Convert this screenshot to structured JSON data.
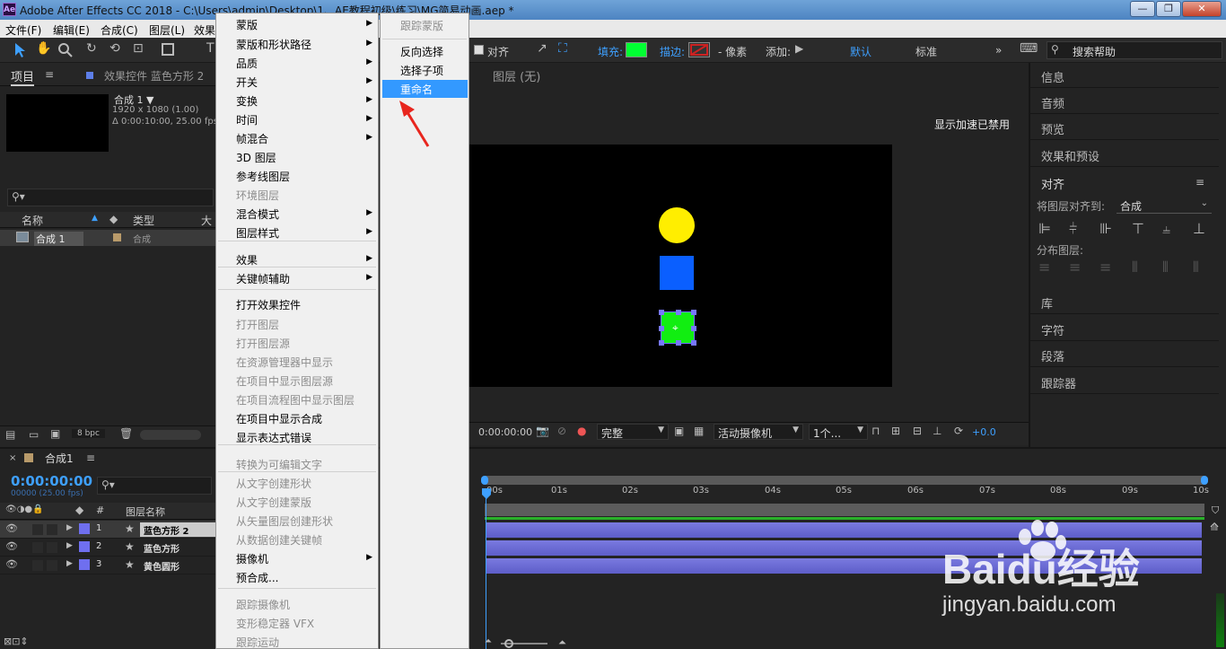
{
  "window": {
    "title": "Adobe After Effects CC 2018 - C:\\Users\\admin\\Desktop\\1、AE教程初级\\练习\\MG简易动画.aep *",
    "app_badge": "Ae",
    "minimize": "—",
    "restore": "❐",
    "close": "✕"
  },
  "menubar": [
    "文件(F)",
    "编辑(E)",
    "合成(C)",
    "图层(L)",
    "效果"
  ],
  "toolbar": {
    "align_label": "对齐",
    "fill_label": "填充:",
    "stroke_label": "描边:",
    "pixels_label": "- 像素",
    "add_label": "添加:",
    "workspace_default": "默认",
    "workspace_standard": "标准",
    "more": "»",
    "search_placeholder": "搜索帮助",
    "fill_color": "#00ff33",
    "stroke_color": "#cc2222"
  },
  "project_panel": {
    "tab_project": "项目",
    "tab_effects": "效果控件 蓝色方形 2",
    "comp_name": "合成 1 ▼",
    "comp_res": "1920 x 1080 (1.00)",
    "comp_dur": "Δ 0:00:10:00, 25.00 fps",
    "col_name": "名称",
    "col_type": "类型",
    "col_size": "大",
    "item_name": "合成 1",
    "item_type": "合成",
    "bpc": "8 bpc"
  },
  "viewer": {
    "layer_label": "图层  (无)",
    "accel_disabled": "显示加速已禁用",
    "timecode": "0:00:00:00",
    "quality": "完整",
    "camera": "活动摄像机",
    "views": "1个...",
    "exposure": "+0.0"
  },
  "right_panel": {
    "items": [
      "信息",
      "音频",
      "预览",
      "效果和预设"
    ],
    "align_title": "对齐",
    "align_to_label": "将图层对齐到:",
    "align_to_value": "合成",
    "distribute_label": "分布图层:",
    "lower_items": [
      "库",
      "字符",
      "段落",
      "跟踪器"
    ]
  },
  "context_menu": {
    "items": [
      {
        "label": "蒙版",
        "sub": true,
        "dis": false
      },
      {
        "label": "蒙版和形状路径",
        "sub": true,
        "dis": false
      },
      {
        "label": "品质",
        "sub": true,
        "dis": false
      },
      {
        "label": "开关",
        "sub": true,
        "dis": false
      },
      {
        "label": "变换",
        "sub": true,
        "dis": false
      },
      {
        "label": "时间",
        "sub": true,
        "dis": false
      },
      {
        "label": "帧混合",
        "sub": true,
        "dis": false
      },
      {
        "label": "3D 图层",
        "sub": false,
        "dis": false
      },
      {
        "label": "参考线图层",
        "sub": false,
        "dis": false
      },
      {
        "label": "环境图层",
        "sub": false,
        "dis": true
      },
      {
        "label": "混合模式",
        "sub": true,
        "dis": false
      },
      {
        "label": "图层样式",
        "sub": true,
        "dis": false
      },
      {
        "label": "效果",
        "sub": true,
        "dis": false
      },
      {
        "label": "关键帧辅助",
        "sub": true,
        "dis": false
      },
      {
        "label": "打开效果控件",
        "sub": false,
        "dis": false
      },
      {
        "label": "打开图层",
        "sub": false,
        "dis": true
      },
      {
        "label": "打开图层源",
        "sub": false,
        "dis": true
      },
      {
        "label": "在资源管理器中显示",
        "sub": false,
        "dis": true
      },
      {
        "label": "在项目中显示图层源",
        "sub": false,
        "dis": true
      },
      {
        "label": "在项目流程图中显示图层",
        "sub": false,
        "dis": true
      },
      {
        "label": "在项目中显示合成",
        "sub": false,
        "dis": false
      },
      {
        "label": "显示表达式错误",
        "sub": false,
        "dis": false
      },
      {
        "label": "转换为可编辑文字",
        "sub": false,
        "dis": true
      },
      {
        "label": "从文字创建形状",
        "sub": false,
        "dis": true
      },
      {
        "label": "从文字创建蒙版",
        "sub": false,
        "dis": true
      },
      {
        "label": "从矢量图层创建形状",
        "sub": false,
        "dis": true
      },
      {
        "label": "从数据创建关键帧",
        "sub": false,
        "dis": true
      },
      {
        "label": "摄像机",
        "sub": true,
        "dis": false
      },
      {
        "label": "预合成...",
        "sub": false,
        "dis": false
      },
      {
        "label": "跟踪摄像机",
        "sub": false,
        "dis": true
      },
      {
        "label": "变形稳定器 VFX",
        "sub": false,
        "dis": true
      },
      {
        "label": "跟踪运动",
        "sub": false,
        "dis": true
      }
    ]
  },
  "submenu": {
    "items": [
      {
        "label": "跟踪蒙版",
        "dis": true
      },
      {
        "label": "反向选择",
        "dis": false
      },
      {
        "label": "选择子项",
        "dis": false
      },
      {
        "label": "重命名",
        "dis": false
      }
    ]
  },
  "timeline": {
    "tab": "合成1",
    "timecode": "0:00:00:00",
    "timecode_sub": "00000 (25.00 fps)",
    "col_hash": "#",
    "col_layer_name": "图层名称",
    "layers": [
      {
        "num": "1",
        "name": "蓝色方形 2"
      },
      {
        "num": "2",
        "name": "蓝色方形"
      },
      {
        "num": "3",
        "name": "黄色圆形"
      }
    ],
    "ticks": [
      "00s",
      "01s",
      "02s",
      "03s",
      "04s",
      "05s",
      "06s",
      "07s",
      "08s",
      "09s",
      "10s"
    ]
  },
  "watermark": {
    "brand": "Baidu经验",
    "url": "jingyan.baidu.com"
  }
}
